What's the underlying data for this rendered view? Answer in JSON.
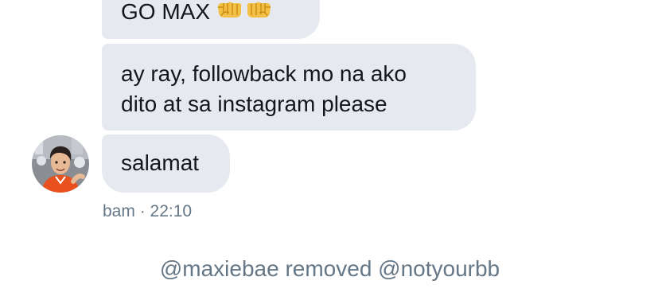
{
  "messages": [
    {
      "text": "GO MAX",
      "emoji": [
        "fist-bump-left-icon",
        "fist-bump-right-icon"
      ]
    },
    {
      "lines": [
        "ay ray, followback mo na ako",
        "dito at sa instagram please"
      ]
    },
    {
      "text": "salamat"
    }
  ],
  "sender": {
    "name": "bam",
    "separator": "·",
    "time": "22:10"
  },
  "event": {
    "text": "@maxiebae removed @notyourbb"
  },
  "colors": {
    "bubble": "#e6e9ef",
    "message_text": "#14171a",
    "secondary_text": "#657786",
    "emoji_skin": "#f2c044",
    "avatar_shirt": "#e8501f"
  }
}
